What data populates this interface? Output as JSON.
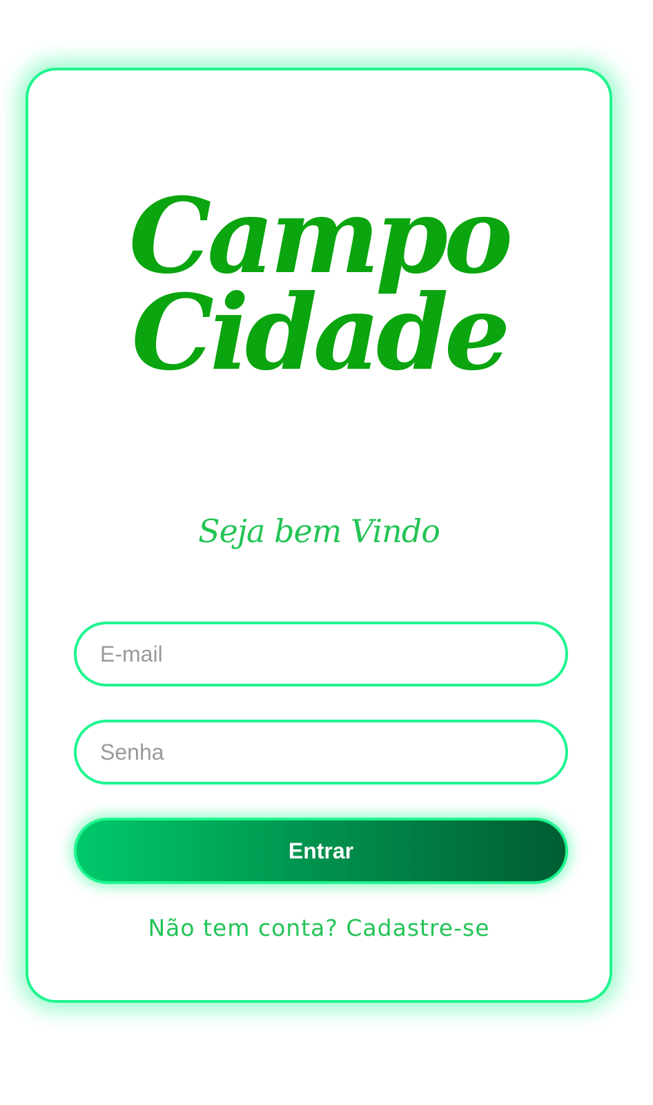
{
  "logo": {
    "line1": "Campo",
    "line2": "Cidade"
  },
  "welcome": "Seja bem Vindo",
  "form": {
    "email_placeholder": "E-mail",
    "email_value": "",
    "password_placeholder": "Senha",
    "password_value": "",
    "submit_label": "Entrar"
  },
  "signup_link": "Não tem conta? Cadastre-se",
  "colors": {
    "brand_green": "#0aa50f",
    "accent_neon": "#1ff58f",
    "text_green": "#23c455",
    "button_gradient_start": "#00c96b",
    "button_gradient_end": "#005c33"
  }
}
